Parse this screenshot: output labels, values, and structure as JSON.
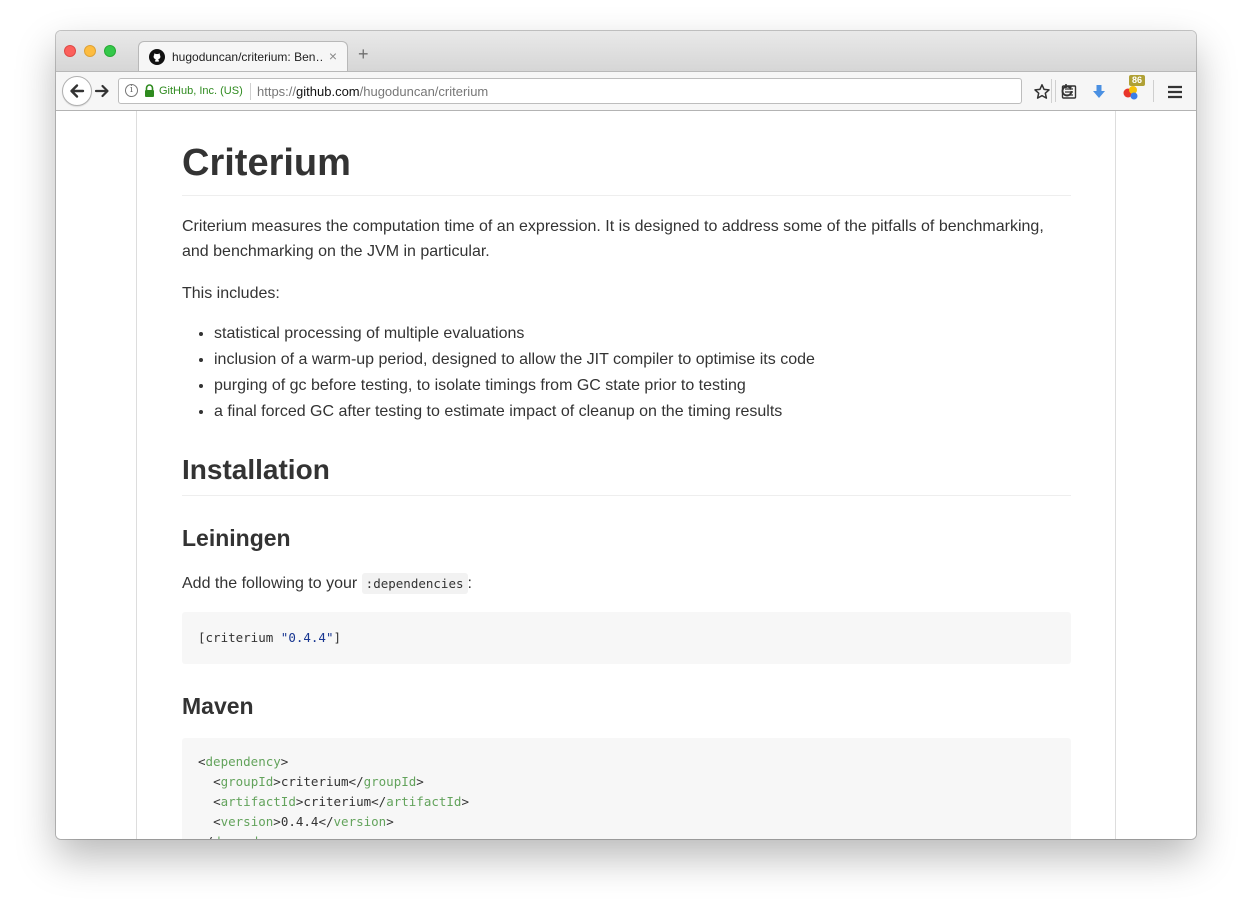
{
  "browser": {
    "tab": {
      "title": "hugoduncan/criterium: Ben…",
      "close_glyph": "×"
    },
    "new_tab_glyph": "+",
    "identity": "GitHub, Inc. (US)",
    "url": {
      "scheme": "https://",
      "host": "github.com",
      "path": "/hugoduncan/criterium"
    },
    "downloads_badge": "86",
    "colors": {
      "identity_green": "#2f8b1f",
      "download_blue": "#4a90e2"
    }
  },
  "readme": {
    "title": "Criterium",
    "intro": "Criterium measures the computation time of an expression. It is designed to address some of the pitfalls of benchmarking, and benchmarking on the JVM in particular.",
    "includes_label": "This includes:",
    "features": [
      "statistical processing of multiple evaluations",
      "inclusion of a warm-up period, designed to allow the JIT compiler to optimise its code",
      "purging of gc before testing, to isolate timings from GC state prior to testing",
      "a final forced GC after testing to estimate impact of cleanup on the timing results"
    ],
    "installation_heading": "Installation",
    "leiningen": {
      "heading": "Leiningen",
      "text_before": "Add the following to your ",
      "inline_code": ":dependencies",
      "text_after": ":",
      "code_prefix": "[criterium ",
      "code_string": "\"0.4.4\"",
      "code_suffix": "]"
    },
    "maven": {
      "heading": "Maven",
      "lines": [
        {
          "indent": "",
          "open": "<",
          "tag": "dependency",
          "close": ">",
          "value": "",
          "end_open": "",
          "end_tag": "",
          "end_close": ""
        },
        {
          "indent": "  ",
          "open": "<",
          "tag": "groupId",
          "close": ">",
          "value": "criterium",
          "end_open": "</",
          "end_tag": "groupId",
          "end_close": ">"
        },
        {
          "indent": "  ",
          "open": "<",
          "tag": "artifactId",
          "close": ">",
          "value": "criterium",
          "end_open": "</",
          "end_tag": "artifactId",
          "end_close": ">"
        },
        {
          "indent": "  ",
          "open": "<",
          "tag": "version",
          "close": ">",
          "value": "0.4.4",
          "end_open": "</",
          "end_tag": "version",
          "end_close": ">"
        },
        {
          "indent": "",
          "open": "</",
          "tag": "dependency",
          "close": ">",
          "value": "",
          "end_open": "",
          "end_tag": "",
          "end_close": ""
        }
      ]
    }
  }
}
